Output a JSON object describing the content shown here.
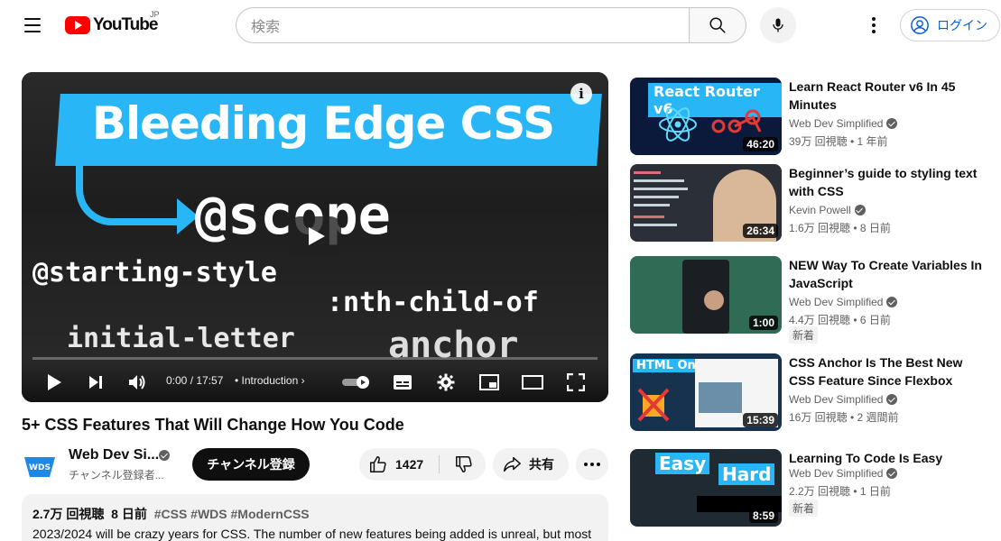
{
  "header": {
    "logo_text": "YouTube",
    "region": "JP",
    "search_placeholder": "検索",
    "login_label": "ログイン"
  },
  "player": {
    "thumb_title": "Bleeding Edge CSS",
    "thumb_scope": "@scope",
    "thumb_starting": "@starting-style",
    "thumb_nth": ":nth-child-of",
    "thumb_initial": "initial-letter",
    "thumb_anchor": "anchor",
    "time": "0:00 / 17:57",
    "chapter": "• Introduction",
    "chapter_arrow": "›",
    "progress": 0
  },
  "video": {
    "title": "5+ CSS Features That Will Change How You Code",
    "channel_name": "Web Dev Si...",
    "channel_subs": "チャンネル登録者...",
    "avatar_text": "WDS",
    "subscribe_label": "チャンネル登録",
    "likes": "1427",
    "share_label": "共有",
    "views": "2.7万 回視聴",
    "age": "8 日前",
    "tags": "#CSS #WDS #ModernCSS",
    "description": "2023/2024 will be crazy years for CSS. The number of new features being added is unreal, but most"
  },
  "recommendations": [
    {
      "title": "Learn React Router v6 In 45 Minutes",
      "channel": "Web Dev Simplified",
      "verified": true,
      "meta": "39万 回視聴 • 1 年前",
      "duration": "46:20",
      "badge": "",
      "thumb_label": "React Router v6",
      "thumb_bg": "#0b1a3a"
    },
    {
      "title": "Beginner’s guide to styling text with CSS",
      "channel": "Kevin Powell",
      "verified": true,
      "meta": "1.6万 回視聴 • 8 日前",
      "duration": "26:34",
      "badge": "",
      "thumb_label": "",
      "thumb_bg": "#2b2f38"
    },
    {
      "title": "NEW Way To Create Variables In JavaScript",
      "channel": "Web Dev Simplified",
      "verified": true,
      "meta": "4.4万 回視聴 • 6 日前",
      "duration": "1:00",
      "badge": "新着",
      "thumb_label": "",
      "thumb_bg": "#2f6b55"
    },
    {
      "title": "CSS Anchor Is The Best New CSS Feature Since Flexbox",
      "channel": "Web Dev Simplified",
      "verified": true,
      "meta": "16万 回視聴 • 2 週間前",
      "duration": "15:39",
      "badge": "",
      "thumb_label": "HTML Only",
      "thumb_bg": "#16324f"
    },
    {
      "title": "Learning To Code Is Easy",
      "channel": "Web Dev Simplified",
      "verified": true,
      "meta": "2.2万 回視聴 • 1 日前",
      "duration": "8:59",
      "badge": "新着",
      "thumb_label": "Easy",
      "thumb_label2": "Hard",
      "thumb_bg": "#1f2a33"
    }
  ],
  "colors": {
    "brand_red": "#ff0000",
    "link_blue": "#065fd4",
    "thumb_accent": "#29b6f6"
  }
}
